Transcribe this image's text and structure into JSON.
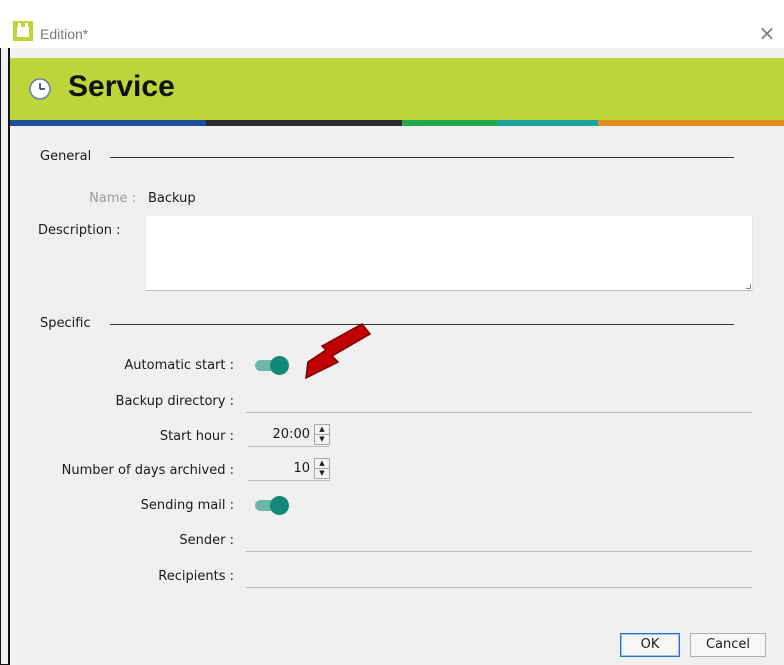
{
  "window": {
    "title": "Edition*",
    "close_glyph": "×",
    "app_icon": "app-window-icon",
    "close_icon": "close-icon"
  },
  "banner": {
    "title": "Service",
    "icon": "clock-icon",
    "background": "#bdd43b",
    "stripe_colors": [
      "#1f4e9c",
      "#2b2b2b",
      "#23a84a",
      "#19a39a",
      "#e58a1f"
    ]
  },
  "general": {
    "section_title": "General",
    "name_label": "Name :",
    "name_value": "Backup",
    "description_label": "Description :",
    "description_value": ""
  },
  "specific": {
    "section_title": "Specific",
    "automatic_start_label": "Automatic start :",
    "automatic_start_on": true,
    "backup_directory_label": "Backup directory :",
    "backup_directory_value": "",
    "start_hour_label": "Start hour :",
    "start_hour_value": "20:00",
    "days_archived_label": "Number of days archived :",
    "days_archived_value": "10",
    "sending_mail_label": "Sending mail :",
    "sending_mail_on": true,
    "sender_label": "Sender :",
    "sender_value": "",
    "recipients_label": "Recipients :",
    "recipients_value": ""
  },
  "footer": {
    "ok_label": "OK",
    "cancel_label": "Cancel"
  },
  "colors": {
    "toggle_track": "#6fb5a8",
    "toggle_knob": "#12887a",
    "annotation_arrow": "#c00000"
  }
}
